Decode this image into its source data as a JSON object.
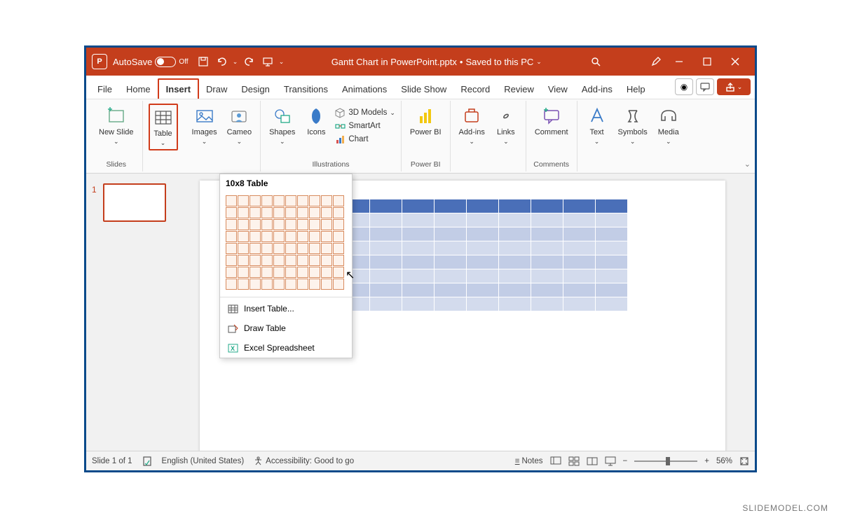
{
  "titlebar": {
    "autosave_label": "AutoSave",
    "autosave_state": "Off",
    "filename": "Gantt Chart in PowerPoint.pptx",
    "save_status": "Saved to this PC"
  },
  "tabs": [
    "File",
    "Home",
    "Insert",
    "Draw",
    "Design",
    "Transitions",
    "Animations",
    "Slide Show",
    "Record",
    "Review",
    "View",
    "Add-ins",
    "Help"
  ],
  "active_tab": "Insert",
  "ribbon": {
    "slides": {
      "label": "Slides",
      "new_slide": "New Slide"
    },
    "tables": {
      "table_label": "Table"
    },
    "images": {
      "images_label": "Images",
      "cameo_label": "Cameo"
    },
    "illustrations": {
      "label": "Illustrations",
      "shapes": "Shapes",
      "icons": "Icons",
      "models": "3D Models",
      "smartart": "SmartArt",
      "chart": "Chart"
    },
    "powerbi": {
      "label": "Power BI",
      "btn": "Power BI"
    },
    "addins": {
      "btn": "Add-ins"
    },
    "links": {
      "btn": "Links"
    },
    "comments": {
      "label": "Comments",
      "btn": "Comment"
    },
    "text": {
      "btn": "Text"
    },
    "symbols": {
      "btn": "Symbols"
    },
    "media": {
      "btn": "Media"
    }
  },
  "table_dropdown": {
    "size_label": "10x8 Table",
    "rows": 8,
    "cols": 10,
    "insert_table": "Insert Table...",
    "draw_table": "Draw Table",
    "excel": "Excel Spreadsheet"
  },
  "thumbnail": {
    "number": "1"
  },
  "preview": {
    "rows": 8,
    "cols": 10
  },
  "statusbar": {
    "slide": "Slide 1 of 1",
    "language": "English (United States)",
    "accessibility": "Accessibility: Good to go",
    "notes": "Notes",
    "zoom": "56%"
  },
  "watermark": "SLIDEMODEL.COM",
  "colors": {
    "accent": "#c43e1c",
    "frame": "#0a4a8a",
    "table_header": "#4a6fb8"
  }
}
